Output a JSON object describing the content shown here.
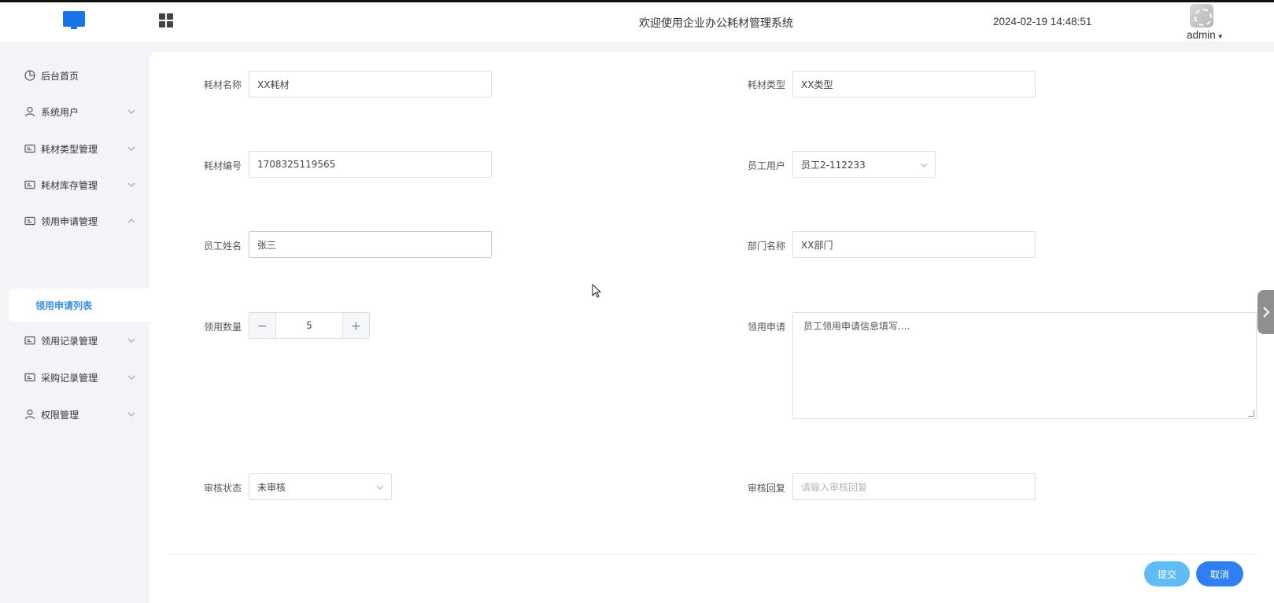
{
  "header": {
    "app_title": "欢迎使用企业办公耗材管理系统",
    "datetime": "2024-02-19 14:48:51",
    "user_name": "admin",
    "logo_icon": "monitor-icon",
    "menu_icon": "grid-icon"
  },
  "sidebar": {
    "items": [
      {
        "label": "后台首页",
        "icon": "pie-chart-icon",
        "expandable": false
      },
      {
        "label": "系统用户",
        "icon": "user-icon",
        "expandable": true
      },
      {
        "label": "耗材类型管理",
        "icon": "card-icon",
        "expandable": true
      },
      {
        "label": "耗材库存管理",
        "icon": "card-icon",
        "expandable": true
      },
      {
        "label": "领用申请管理",
        "icon": "card-icon",
        "expandable": true,
        "expanded": true
      },
      {
        "label": "领用记录管理",
        "icon": "card-icon",
        "expandable": true
      },
      {
        "label": "采购记录管理",
        "icon": "card-icon",
        "expandable": true
      },
      {
        "label": "权限管理",
        "icon": "user-icon",
        "expandable": true
      }
    ],
    "active_sub_item": "领用申请列表"
  },
  "form": {
    "consumable_name": {
      "label": "耗材名称",
      "value": "XX耗材"
    },
    "consumable_type": {
      "label": "耗材类型",
      "value": "XX类型"
    },
    "consumable_code": {
      "label": "耗材编号",
      "value": "1708325119565"
    },
    "employee_user": {
      "label": "员工用户",
      "value": "员工2-112233"
    },
    "employee_name": {
      "label": "员工姓名",
      "value": "张三"
    },
    "department": {
      "label": "部门名称",
      "value": "XX部门"
    },
    "quantity": {
      "label": "领用数量",
      "value": "5",
      "minus": "−",
      "plus": "+"
    },
    "application": {
      "label": "领用申请",
      "value": "员工领用申请信息填写...."
    },
    "review_status": {
      "label": "审核状态",
      "value": "未审核"
    },
    "review_reply": {
      "label": "审核回复",
      "placeholder": "请输入审核回复"
    }
  },
  "actions": {
    "submit_label": "提交",
    "cancel_label": "取消"
  },
  "colors": {
    "accent": "#2f7ff2",
    "submit": "#5fbcf5",
    "active_nav": "#3a8ee6"
  }
}
